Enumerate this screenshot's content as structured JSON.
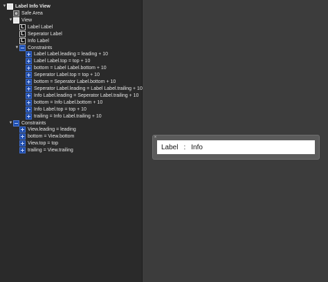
{
  "outline": {
    "items": [
      {
        "label": "Label Info View",
        "icon": "view-icon",
        "indent": 0,
        "tri": "▼",
        "bold": true
      },
      {
        "label": "Safe Area",
        "icon": "safe-area-icon",
        "indent": 1,
        "tri": ""
      },
      {
        "label": "View",
        "icon": "view-icon",
        "indent": 1,
        "tri": "▼"
      },
      {
        "label": "Label Label",
        "icon": "label-icon",
        "indent": 2,
        "tri": ""
      },
      {
        "label": "Seperator Label",
        "icon": "label-icon",
        "indent": 2,
        "tri": ""
      },
      {
        "label": "Info Label",
        "icon": "label-icon",
        "indent": 2,
        "tri": ""
      },
      {
        "label": "Constraints",
        "icon": "constraints-group-icon",
        "indent": 2,
        "tri": "▼"
      },
      {
        "label": "Label Label.leading = leading + 10",
        "icon": "constraint-icon",
        "indent": 3,
        "tri": ""
      },
      {
        "label": "Label Label.top = top + 10",
        "icon": "constraint-icon",
        "indent": 3,
        "tri": ""
      },
      {
        "label": "bottom = Label Label.bottom + 10",
        "icon": "constraint-icon",
        "indent": 3,
        "tri": ""
      },
      {
        "label": "Seperator Label.top = top + 10",
        "icon": "constraint-icon",
        "indent": 3,
        "tri": ""
      },
      {
        "label": "bottom = Seperator Label.bottom + 10",
        "icon": "constraint-icon",
        "indent": 3,
        "tri": ""
      },
      {
        "label": "Seperator Label.leading = Label Label.trailing + 10",
        "icon": "constraint-icon",
        "indent": 3,
        "tri": ""
      },
      {
        "label": "Info Label.leading = Seperator Label.trailing + 10",
        "icon": "constraint-icon",
        "indent": 3,
        "tri": ""
      },
      {
        "label": "bottom = Info Label.bottom + 10",
        "icon": "constraint-icon",
        "indent": 3,
        "tri": ""
      },
      {
        "label": "Info Label.top = top + 10",
        "icon": "constraint-icon",
        "indent": 3,
        "tri": ""
      },
      {
        "label": "trailing = Info Label.trailing + 10",
        "icon": "constraint-icon",
        "indent": 3,
        "tri": ""
      },
      {
        "label": "Constraints",
        "icon": "constraints-group-icon",
        "indent": 1,
        "tri": "▼"
      },
      {
        "label": "View.leading = leading",
        "icon": "constraint-icon",
        "indent": 2,
        "tri": ""
      },
      {
        "label": "bottom = View.bottom",
        "icon": "constraint-icon",
        "indent": 2,
        "tri": ""
      },
      {
        "label": "View.top = top",
        "icon": "constraint-icon",
        "indent": 2,
        "tri": ""
      },
      {
        "label": "trailing = View.trailing",
        "icon": "constraint-icon",
        "indent": 2,
        "tri": ""
      }
    ]
  },
  "canvas": {
    "close_glyph": "×",
    "label_text": "Label",
    "separator_text": ":",
    "info_text": "Info"
  }
}
